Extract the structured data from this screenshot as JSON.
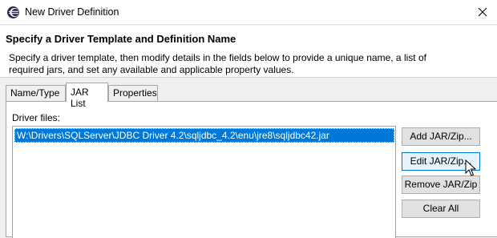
{
  "window": {
    "title": "New Driver Definition",
    "icon": "eclipse-icon",
    "close_glyph": "close-icon"
  },
  "header": {
    "title": "Specify a Driver Template and Definition Name",
    "description": "Specify a driver template, then modify details in the fields below to provide a unique name, a list of required jars, and set any available and applicable property values."
  },
  "tabs": [
    {
      "label": "Name/Type",
      "active": false
    },
    {
      "label": "JAR List",
      "active": true
    },
    {
      "label": "Properties",
      "active": false
    }
  ],
  "jar_list": {
    "label": "Driver files:",
    "items": [
      {
        "path": "W:\\Drivers\\SQLServer\\JDBC Driver 4.2\\sqljdbc_4.2\\enu\\jre8\\sqljdbc42.jar",
        "selected": true
      }
    ]
  },
  "buttons": {
    "add": "Add JAR/Zip...",
    "edit": "Edit JAR/Zip...",
    "remove": "Remove JAR/Zip",
    "clear": "Clear All"
  },
  "colors": {
    "selection": "#0078d7",
    "hover_border": "#0078d7",
    "hover_fill": "#e5f1fb"
  }
}
